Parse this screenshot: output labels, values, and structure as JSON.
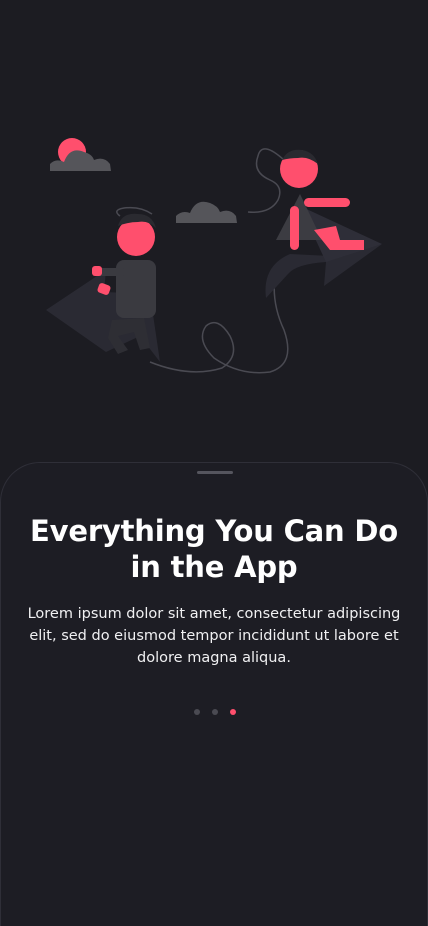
{
  "onboarding": {
    "title": "Everything You Can Do in the App",
    "description": "Lorem ipsum dolor sit amet, consectetur adipiscing elit, sed do eiusmod tempor incididunt ut labore et dolore magna aliqua.",
    "pagination": {
      "total": 3,
      "active_index": 2
    }
  },
  "colors": {
    "background": "#1c1c22",
    "accent": "#ff4f6d",
    "inactive_dot": "#4a4a52",
    "text": "#ffffff"
  },
  "icons": {
    "illustration": "people-riding-paper-planes-illustration",
    "sheet_handle": "drag-handle"
  }
}
